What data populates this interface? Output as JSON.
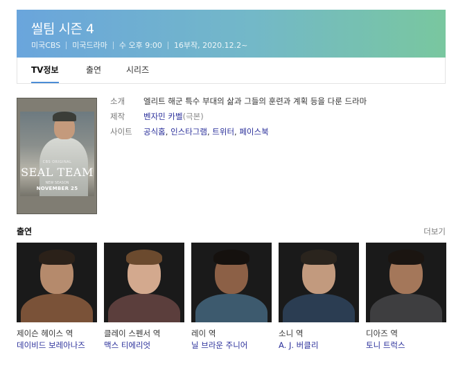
{
  "header": {
    "title": "씰팀 시즌 4",
    "meta": [
      "미국CBS",
      "미국드라마",
      "수 오후 9:00",
      "16부작, 2020.12.2~"
    ]
  },
  "tabs": [
    {
      "label": "TV정보",
      "active": true
    },
    {
      "label": "출연",
      "active": false
    },
    {
      "label": "시리즈",
      "active": false
    }
  ],
  "poster": {
    "small_text": "CBS ORIGINAL",
    "brand": "SEAL TEAM",
    "season_text": "NEW SEASON",
    "date_text": "NOVEMBER 25"
  },
  "info": {
    "summary_key": "소개",
    "summary_value": "엘리트 해군 특수 부대의 삶과 그들의 훈련과 계획 등을 다룬 드라마",
    "producer_key": "제작",
    "producer_name": "벤자민 카벨",
    "producer_note": "(극본)",
    "site_key": "사이트",
    "sites": [
      "공식홈",
      "인스타그램",
      "트위터",
      "페이스북"
    ],
    "site_separator": ", "
  },
  "cast_section": {
    "title": "출연",
    "more_label": "더보기",
    "members": [
      {
        "role": "제이슨 헤이스 역",
        "actor": "데이비드 보레아나즈",
        "skin": "#b58a6c",
        "hair": "#2b2119",
        "shirt": "#7a5238"
      },
      {
        "role": "클레이 스펜서 역",
        "actor": "맥스 티에리엇",
        "skin": "#d3a98e",
        "hair": "#6b4a2e",
        "shirt": "#5b3e3c"
      },
      {
        "role": "레이 역",
        "actor": "닐 브라운 주니어",
        "skin": "#8c6046",
        "hair": "#15110e",
        "shirt": "#3d5a6e"
      },
      {
        "role": "소니 역",
        "actor": "A. J. 버클리",
        "skin": "#c29a7e",
        "hair": "#2a241d",
        "shirt": "#2b3d52"
      },
      {
        "role": "디아즈 역",
        "actor": "토니 트럭스",
        "skin": "#a4775a",
        "hair": "#1b1511",
        "shirt": "#3e3e40"
      }
    ]
  }
}
